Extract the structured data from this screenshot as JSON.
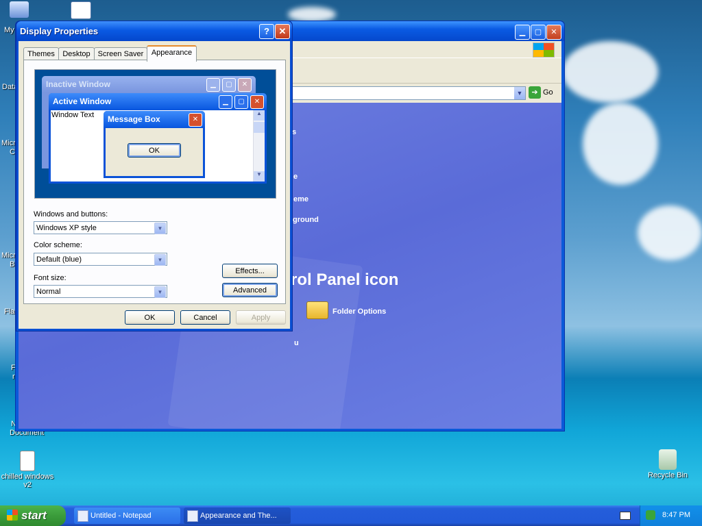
{
  "desktop": {
    "icons_left": [
      "My",
      "Data",
      "Micro",
      "C",
      "Micro",
      "B",
      "Flas",
      "F",
      "r"
    ],
    "new_document": [
      "N",
      "Document"
    ],
    "chilled": [
      "chilled windows",
      "v2"
    ],
    "recycle_bin": "Recycle Bin"
  },
  "control_panel": {
    "address_go": "Go",
    "items": [
      "s",
      "eme",
      "ground",
      "e",
      "u"
    ],
    "heading_fragment": "trol Panel icon",
    "folder_options": "Folder Options"
  },
  "dialog": {
    "title": "Display Properties",
    "help_button": "?",
    "close_button": "✕",
    "tabs": [
      "Themes",
      "Desktop",
      "Screen Saver",
      "Appearance"
    ],
    "active_tab": "Appearance",
    "preview": {
      "inactive_title": "Inactive Window",
      "active_title": "Active Window",
      "window_text": "Window Text",
      "message_title": "Message Box",
      "ok": "OK"
    },
    "windows_buttons_label": "Windows and buttons:",
    "windows_buttons_value": "Windows XP style",
    "color_scheme_label": "Color scheme:",
    "color_scheme_value": "Default (blue)",
    "font_size_label": "Font size:",
    "font_size_value": "Normal",
    "effects": "Effects...",
    "advanced": "Advanced",
    "ok": "OK",
    "cancel": "Cancel",
    "apply": "Apply"
  },
  "taskbar": {
    "start": "start",
    "tasks": [
      "Untitled - Notepad",
      "Appearance and The..."
    ],
    "clock": "8:47 PM"
  },
  "colors": {
    "xp_blue": "#0a5ae3",
    "dialog_face": "#ece9d8",
    "start_green": "#3b9c3b",
    "close_red": "#c3401f"
  }
}
